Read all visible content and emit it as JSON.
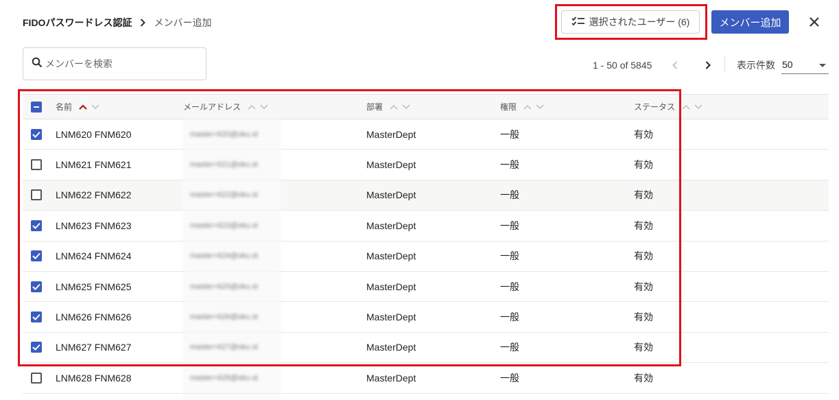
{
  "breadcrumb": {
    "root": "FIDOパスワードレス認証",
    "current": "メンバー追加"
  },
  "header": {
    "selected_users_label": "選択されたユーザー (6)",
    "add_member_label": "メンバー追加",
    "accent_color": "#3a5bc0",
    "highlight_color": "#e3101a"
  },
  "search": {
    "placeholder": "メンバーを検索",
    "value": ""
  },
  "pager": {
    "range": "1 - 50 of 5845",
    "page_size_label": "表示件数",
    "page_size": "50"
  },
  "table": {
    "columns": {
      "name": "名前",
      "email": "メールアドレス",
      "dept": "部署",
      "role": "権限",
      "status": "ステータス"
    },
    "header_checkbox": "indeterminate",
    "rows": [
      {
        "checked": true,
        "name": "LNM620 FNM620",
        "email": "master+620@oku.st",
        "dept": "MasterDept",
        "role": "一般",
        "status": "有効"
      },
      {
        "checked": false,
        "name": "LNM621 FNM621",
        "email": "master+621@oku.st",
        "dept": "MasterDept",
        "role": "一般",
        "status": "有効"
      },
      {
        "checked": false,
        "name": "LNM622 FNM622",
        "email": "master+622@oku.st",
        "dept": "MasterDept",
        "role": "一般",
        "status": "有効"
      },
      {
        "checked": true,
        "name": "LNM623 FNM623",
        "email": "master+623@oku.st",
        "dept": "MasterDept",
        "role": "一般",
        "status": "有効"
      },
      {
        "checked": true,
        "name": "LNM624 FNM624",
        "email": "master+624@oku.st",
        "dept": "MasterDept",
        "role": "一般",
        "status": "有効"
      },
      {
        "checked": true,
        "name": "LNM625 FNM625",
        "email": "master+625@oku.st",
        "dept": "MasterDept",
        "role": "一般",
        "status": "有効"
      },
      {
        "checked": true,
        "name": "LNM626 FNM626",
        "email": "master+626@oku.st",
        "dept": "MasterDept",
        "role": "一般",
        "status": "有効"
      },
      {
        "checked": true,
        "name": "LNM627 FNM627",
        "email": "master+627@oku.st",
        "dept": "MasterDept",
        "role": "一般",
        "status": "有効"
      },
      {
        "checked": false,
        "name": "LNM628 FNM628",
        "email": "master+628@oku.st",
        "dept": "MasterDept",
        "role": "一般",
        "status": "有効"
      }
    ]
  }
}
